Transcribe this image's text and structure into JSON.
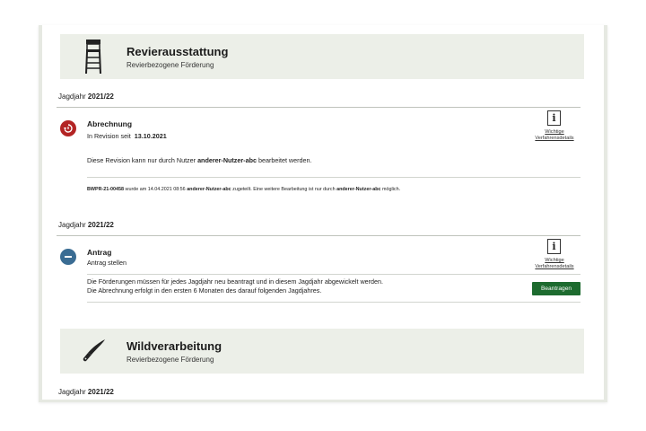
{
  "colors": {
    "banner_bg": "#ecefe8",
    "status_revision": "#b32424",
    "status_request": "#3a6c93",
    "primary_button": "#1d6b2f"
  },
  "sections": [
    {
      "title": "Revierausstattung",
      "subtitle": "Revierbezogene Förderung",
      "icon": "hunting-stand-icon",
      "year_prefix": "Jagdjahr",
      "year_value": "2021/22",
      "card": {
        "status_icon": "revision-icon",
        "title": "Abrechnung",
        "status_prefix": "In Revision seit",
        "status_date": "13.10.2021",
        "info_icon": "info-icon",
        "info_link_line1": "Wichtige",
        "info_link_line2": "Verfahrensdetails",
        "message_prefix": "Diese Revision kann nur durch Nutzer",
        "message_user": "anderer-Nutzer-abc",
        "message_suffix": "bearbeitet werden.",
        "note_id": "BWPR-21-00458",
        "note_mid1": "wurde am 14.04.2021 08:56",
        "note_user1": "anderer-Nutzer-abc",
        "note_mid2": "zugeteilt. Eine weitere Bearbeitung ist nur durch",
        "note_user2": "anderer-Nutzer-abc",
        "note_end": "möglich."
      },
      "year2_prefix": "Jagdjahr",
      "year2_value": "2021/22",
      "card2": {
        "status_icon": "minus-circle-icon",
        "title": "Antrag",
        "subtitle": "Antrag stellen",
        "info_icon": "info-icon",
        "info_link_line1": "Wichtige",
        "info_link_line2": "Verfahrensdetails",
        "text_line1": "Die Förderungen müssen für jedes Jagdjahr neu beantragt und in diesem Jagdjahr abgewickelt werden.",
        "text_line2": "Die Abrechnung erfolgt in den ersten 6 Monaten des darauf folgenden Jagdjahres.",
        "button_label": "Beantragen"
      }
    },
    {
      "title": "Wildverarbeitung",
      "subtitle": "Revierbezogene Förderung",
      "icon": "knife-icon",
      "year_prefix": "Jagdjahr",
      "year_value": "2021/22"
    }
  ]
}
